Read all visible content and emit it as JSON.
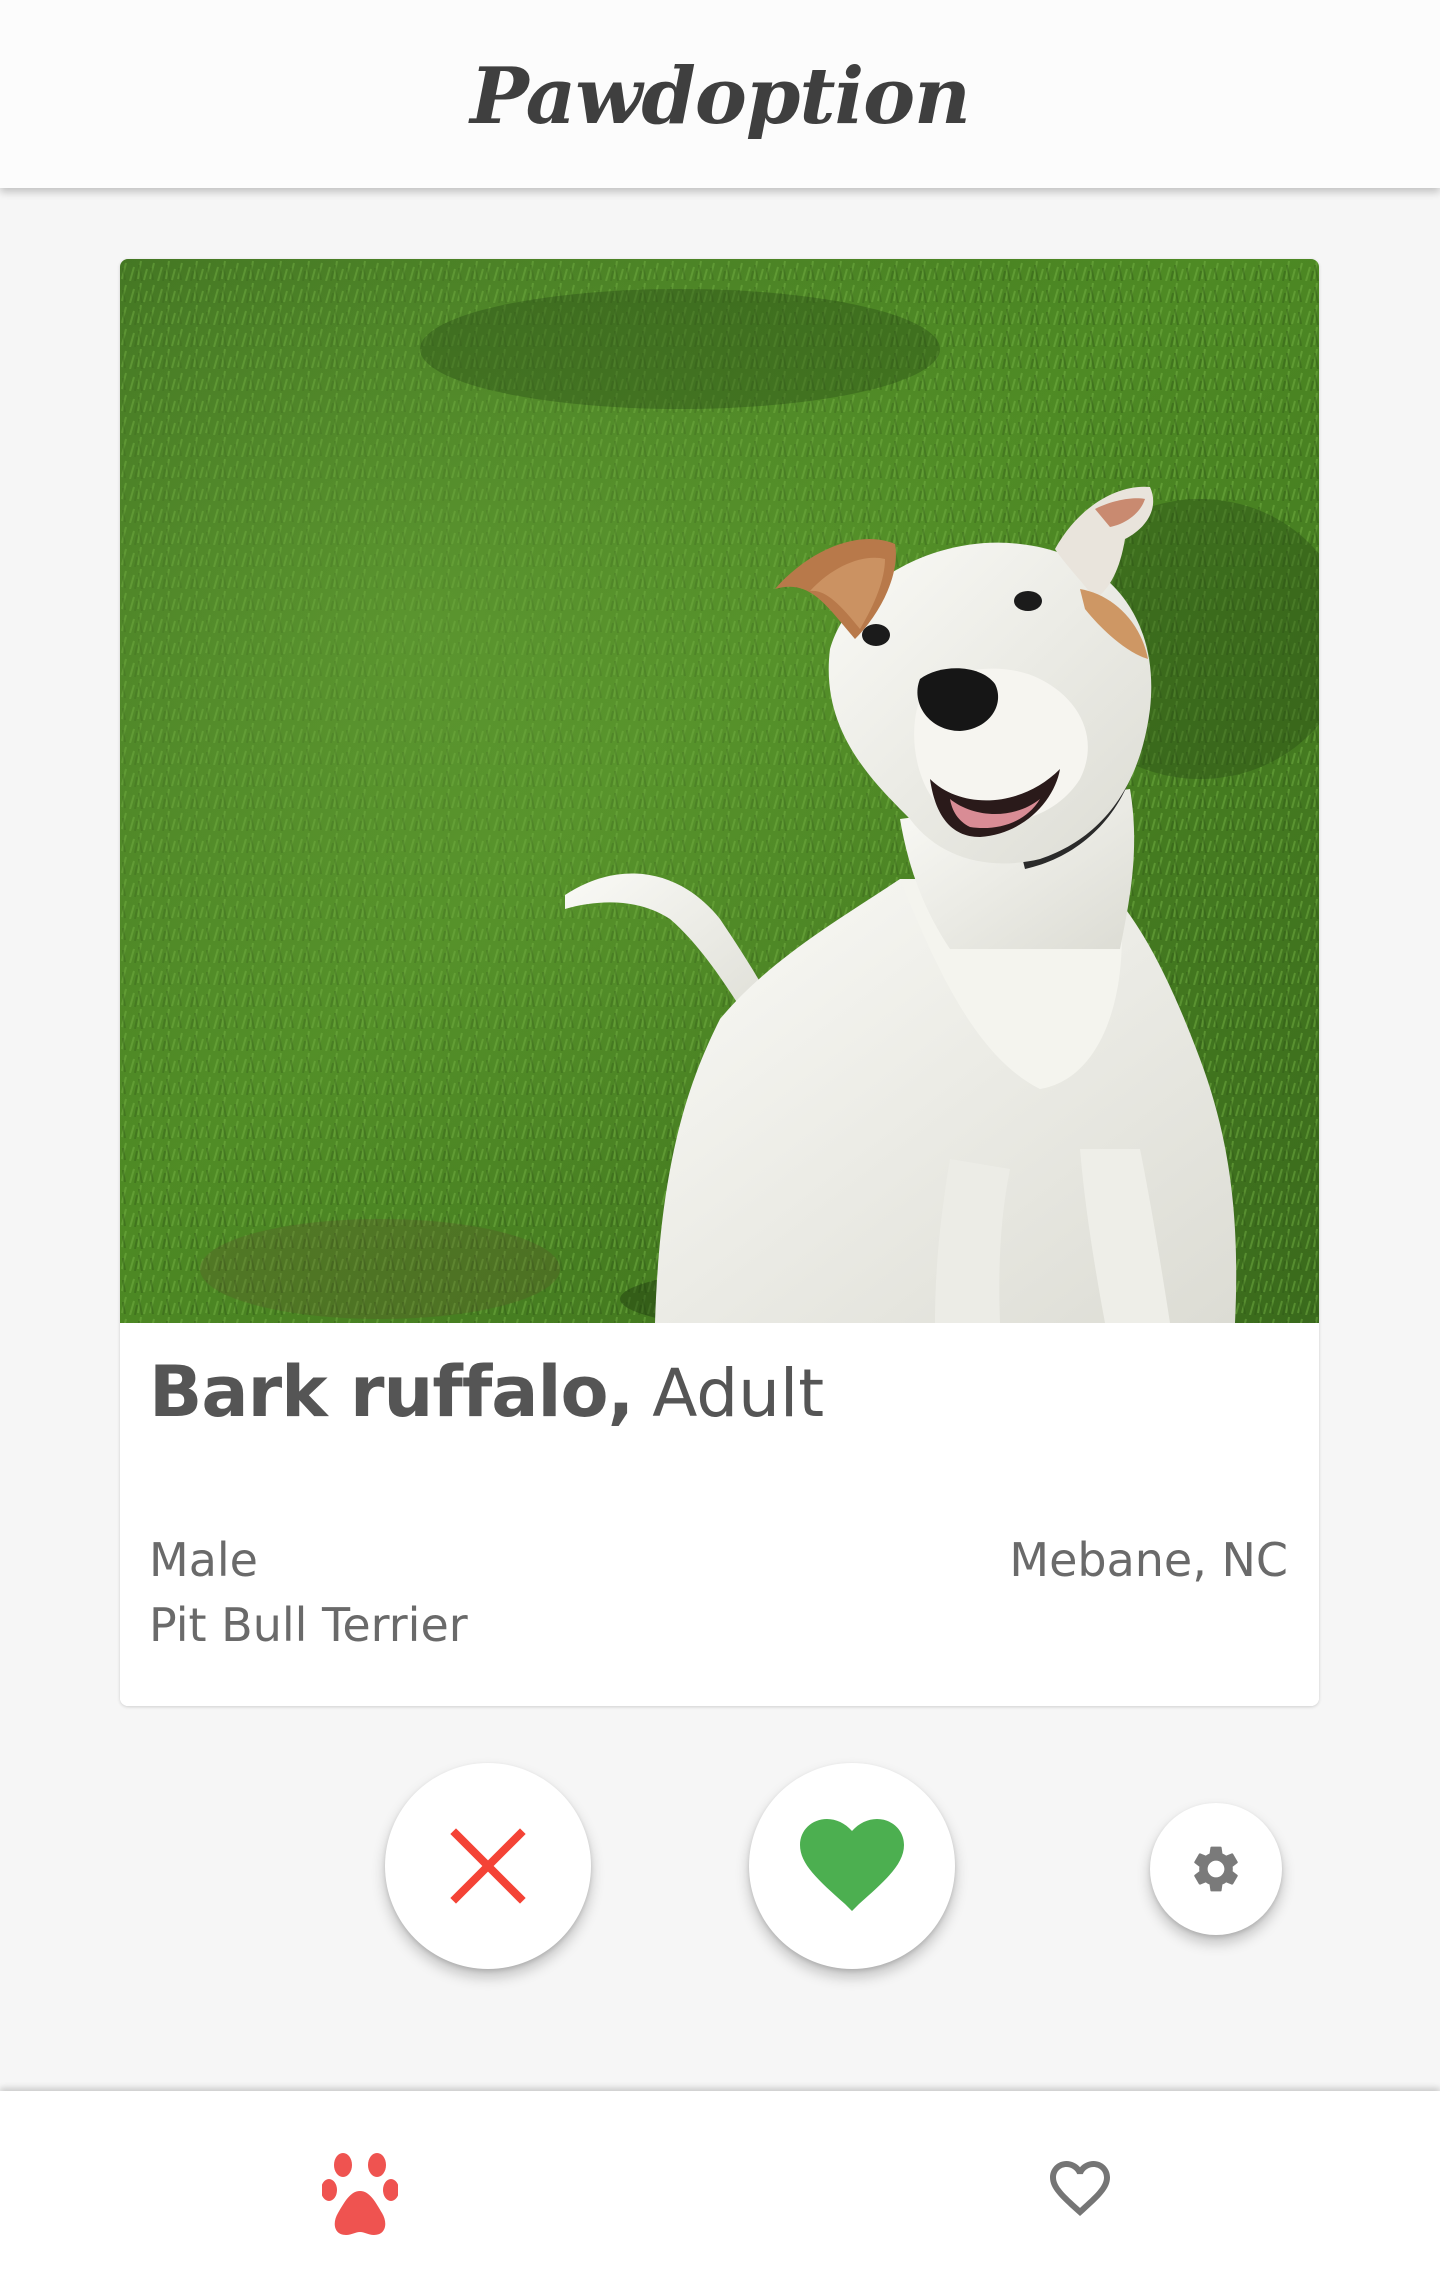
{
  "app": {
    "title": "Pawdoption"
  },
  "pet": {
    "name": "Bark ruffalo",
    "age": "Adult",
    "gender": "Male",
    "breed": "Pit Bull Terrier",
    "location": "Mebane, NC",
    "photo": "white-pit-bull-sitting-on-grass"
  },
  "actions": {
    "nope_icon": "close-icon",
    "like_icon": "heart-icon",
    "settings_icon": "gear-icon"
  },
  "bottom_nav": {
    "tabs": [
      {
        "icon": "paw-icon",
        "active": true
      },
      {
        "icon": "heart-outline-icon",
        "active": false
      }
    ]
  },
  "colors": {
    "nope": "#f44336",
    "like": "#4caf50",
    "accent": "#ef5350",
    "icon_inactive": "#757575",
    "settings_icon": "#7a7a7a"
  }
}
